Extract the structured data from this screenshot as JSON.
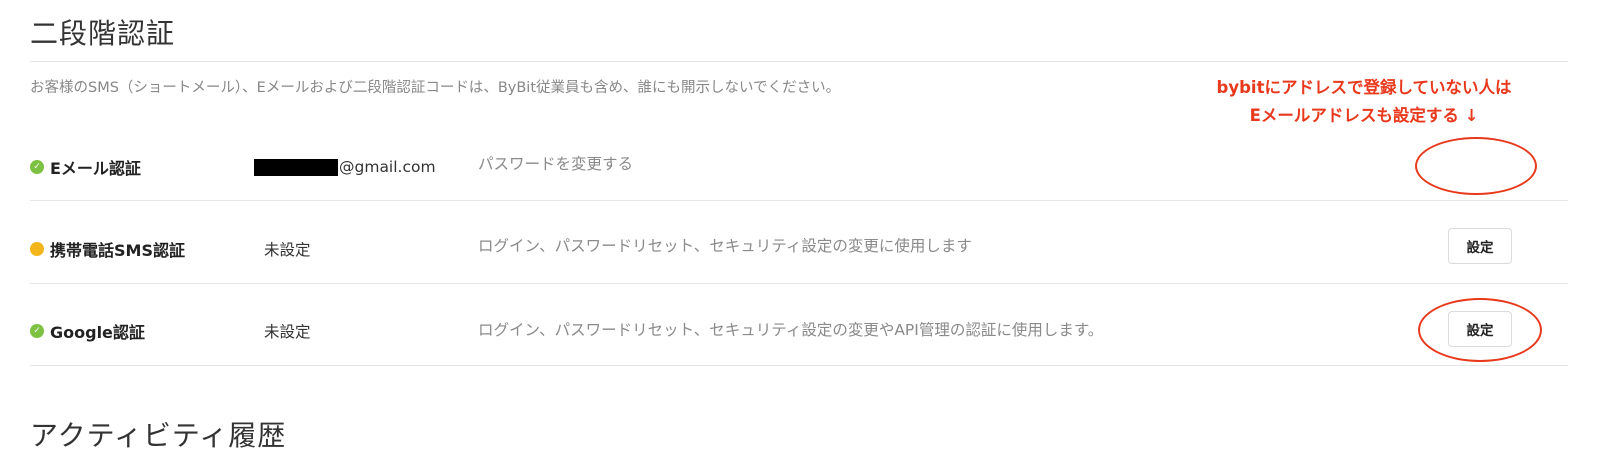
{
  "two_factor": {
    "title": "二段階認証",
    "notice": "お客様のSMS（ショートメール）、Eメールおよび二段階認証コードは、ByBit従業員も含め、誰にも開示しないでください。",
    "annotation_line1": "bybitにアドレスで登録していない人は",
    "annotation_line2": "Eメールアドレスも設定する ↓",
    "email": {
      "status": "ok",
      "label": "Eメール認証",
      "value_suffix": "@gmail.com",
      "description": "パスワードを変更する"
    },
    "sms": {
      "status": "warning",
      "label": "携帯電話SMS認証",
      "value": "未設定",
      "description": "ログイン、パスワードリセット、セキュリティ設定の変更に使用します",
      "button_label": "設定"
    },
    "google": {
      "status": "ok",
      "label": "Google認証",
      "value": "未設定",
      "description": "ログイン、パスワードリセット、セキュリティ設定の変更やAPI管理の認証に使用します。",
      "button_label": "設定"
    }
  },
  "activity": {
    "title": "アクティビティ履歴"
  },
  "colors": {
    "annotation_red": "#e8391d",
    "status_ok": "#7cc142",
    "status_warning": "#f2b51a"
  }
}
